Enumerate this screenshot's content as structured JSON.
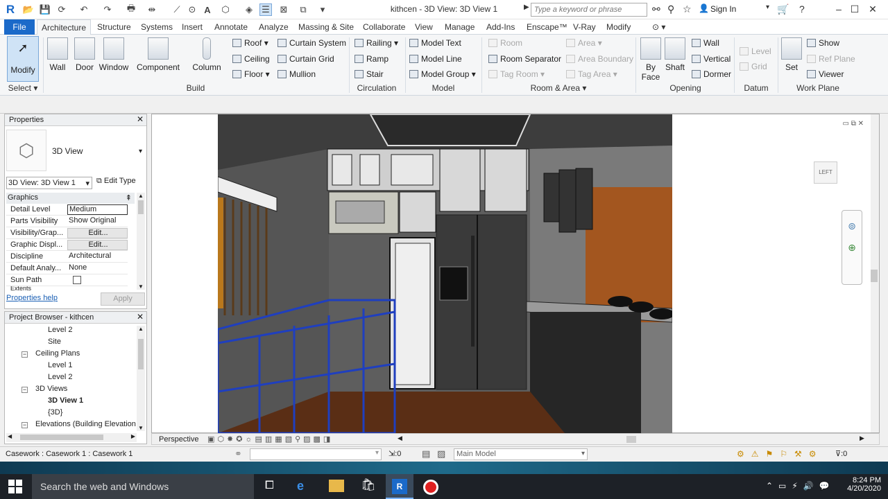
{
  "window": {
    "title": "kithcen - 3D View: 3D View 1",
    "search_placeholder": "Type a keyword or phrase",
    "sign_in": "Sign In"
  },
  "tabs": [
    "File",
    "Architecture",
    "Structure",
    "Systems",
    "Insert",
    "Annotate",
    "Analyze",
    "Massing & Site",
    "Collaborate",
    "View",
    "Manage",
    "Add-Ins",
    "Enscape™",
    "V-Ray",
    "Modify"
  ],
  "ribbon": {
    "modify": "Modify",
    "build_big": [
      "Wall",
      "Door",
      "Window",
      "Component",
      "Column"
    ],
    "build_small": [
      "Roof",
      "Ceiling",
      "Floor",
      "Curtain System",
      "Curtain Grid",
      "Mullion"
    ],
    "circulation": [
      "Railing",
      "Ramp",
      "Stair"
    ],
    "model": [
      "Model Text",
      "Model Line",
      "Model Group"
    ],
    "room_area": [
      "Room",
      "Room Separator",
      "Tag Room",
      "Area",
      "Area Boundary",
      "Tag Area"
    ],
    "opening": {
      "big": [
        "By Face",
        "Shaft"
      ],
      "small": [
        "Wall",
        "Vertical",
        "Dormer"
      ]
    },
    "datum": [
      "Level",
      "Grid"
    ],
    "work_plane": {
      "set": "Set",
      "small": [
        "Show",
        "Ref Plane",
        "Viewer"
      ]
    },
    "panels": [
      "Select",
      "Build",
      "Circulation",
      "Model",
      "Room & Area",
      "Opening",
      "Datum",
      "Work Plane"
    ]
  },
  "properties": {
    "title": "Properties",
    "type_name": "3D View",
    "instance": "3D View: 3D View 1",
    "edit_type": "Edit Type",
    "group": "Graphics",
    "rows": [
      {
        "label": "Detail Level",
        "value": "Medium"
      },
      {
        "label": "Parts Visibility",
        "value": "Show Original"
      },
      {
        "label": "Visibility/Grap...",
        "value": "Edit..."
      },
      {
        "label": "Graphic Displ...",
        "value": "Edit..."
      },
      {
        "label": "Discipline",
        "value": "Architectural"
      },
      {
        "label": "Default Analy...",
        "value": "None"
      },
      {
        "label": "Sun Path",
        "value": ""
      }
    ],
    "next_group": "Extents",
    "help": "Properties help",
    "apply": "Apply"
  },
  "browser": {
    "title": "Project Browser - kithcen",
    "items": [
      "Level 2",
      "Site",
      "Ceiling Plans",
      "Level 1",
      "Level 2",
      "3D Views",
      "3D View 1",
      "{3D}",
      "Elevations (Building Elevation"
    ]
  },
  "view": {
    "mode": "Perspective",
    "cube": "LEFT"
  },
  "status": {
    "selection": "Casework : Casework 1 : Casework 1",
    "count": ":0",
    "model": "Main Model",
    "filter": ":0"
  },
  "taskbar": {
    "search": "Search the web and Windows",
    "time": "8:24 PM",
    "date": "4/20/2020"
  }
}
